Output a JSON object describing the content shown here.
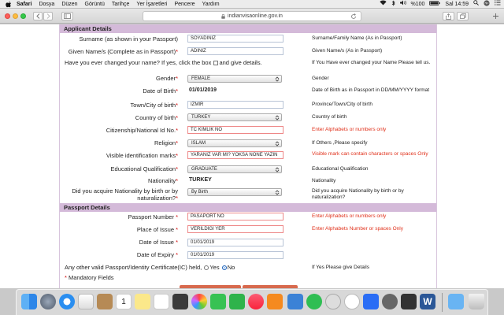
{
  "menubar": {
    "items": [
      "Safari",
      "Dosya",
      "Düzen",
      "Görüntü",
      "Tarihçe",
      "Yer İşaretleri",
      "Pencere",
      "Yardım"
    ],
    "battery": "%100",
    "clock": "Sal 14:59"
  },
  "browser": {
    "url": "indianvisaonline.gov.in"
  },
  "applicant": {
    "section_title": "Applicant Details",
    "surname_label": "Surname (as shown in your Passport)",
    "surname_value": "SOYADINIZ",
    "surname_hint": "Surname/Family Name (As in Passport)",
    "given_label": "Given Name/s (Complete as in Passport)",
    "given_value": "ADINIZ",
    "given_hint": "Given Name/s (As in Passport)",
    "changed_label_a": "Have you ever changed your name? If yes, click the box",
    "changed_label_b": "and give details.",
    "changed_hint": "If You Have ever changed your Name Please tell us.",
    "gender_label": "Gender",
    "gender_value": "FEMALE",
    "gender_hint": "Gender",
    "dob_label": "Date of Birth",
    "dob_value": "01/01/2019",
    "dob_hint": "Date of Birth as in Passport in DD/MM/YYYY format",
    "town_label": "Town/City of birth",
    "town_value": "IZMIR",
    "town_hint": "Province/Town/City of birth",
    "country_label": "Country of birth",
    "country_value": "TURKEY",
    "country_hint": "Country of birth",
    "citizen_label": "Citizenship/National Id No.",
    "citizen_value": "TC KİMLİK NO",
    "citizen_hint": "Enter Alphabets or numbers only",
    "religion_label": "Religion",
    "religion_value": "ISLAM",
    "religion_hint": "If Others ,Please specify",
    "marks_label": "Visible identification marks",
    "marks_value": "YARANIZ VAR MI? YOKSA NONE YAZIN",
    "marks_hint": "Visible mark can contain characters or spaces Only",
    "edu_label": "Educational Qualification",
    "edu_value": "GRADUATE",
    "edu_hint": "Educational Qualification",
    "nationality_label": "Nationality",
    "nationality_value": "TURKEY",
    "nationality_hint": "Nationality",
    "acquire_label_a": "Did you acquire Nationality by birth or by",
    "acquire_label_b": "naturalization?",
    "acquire_value": "By Birth",
    "acquire_hint": "Did you acquire Nationality by birth or by naturalization?"
  },
  "passport": {
    "section_title": "Passport Details",
    "number_label": "Passport Number",
    "number_value": "PASAPORT NO",
    "number_hint": "Enter Alphabets or numbers only",
    "place_label": "Place of Issue",
    "place_value": "VERİLDİĞİ YER",
    "place_hint": "Enter Alphabets Number or spaces Only",
    "issue_label": "Date of Issue",
    "issue_value": "01/01/2019",
    "expiry_label": "Date of Expiry",
    "expiry_value": "01/01/2019",
    "other_label": "Any other valid Passport/Identity Certificate(IC) held,",
    "other_yes": "Yes",
    "other_no": "No",
    "other_hint": "If Yes Please give Details",
    "mandatory": "Mandatory Fields"
  },
  "dock": {
    "calendar_day": "1"
  },
  "colors": {
    "section_bg": "#d4bad9",
    "required_star": "#d00000",
    "error_hint": "#e0301a"
  }
}
